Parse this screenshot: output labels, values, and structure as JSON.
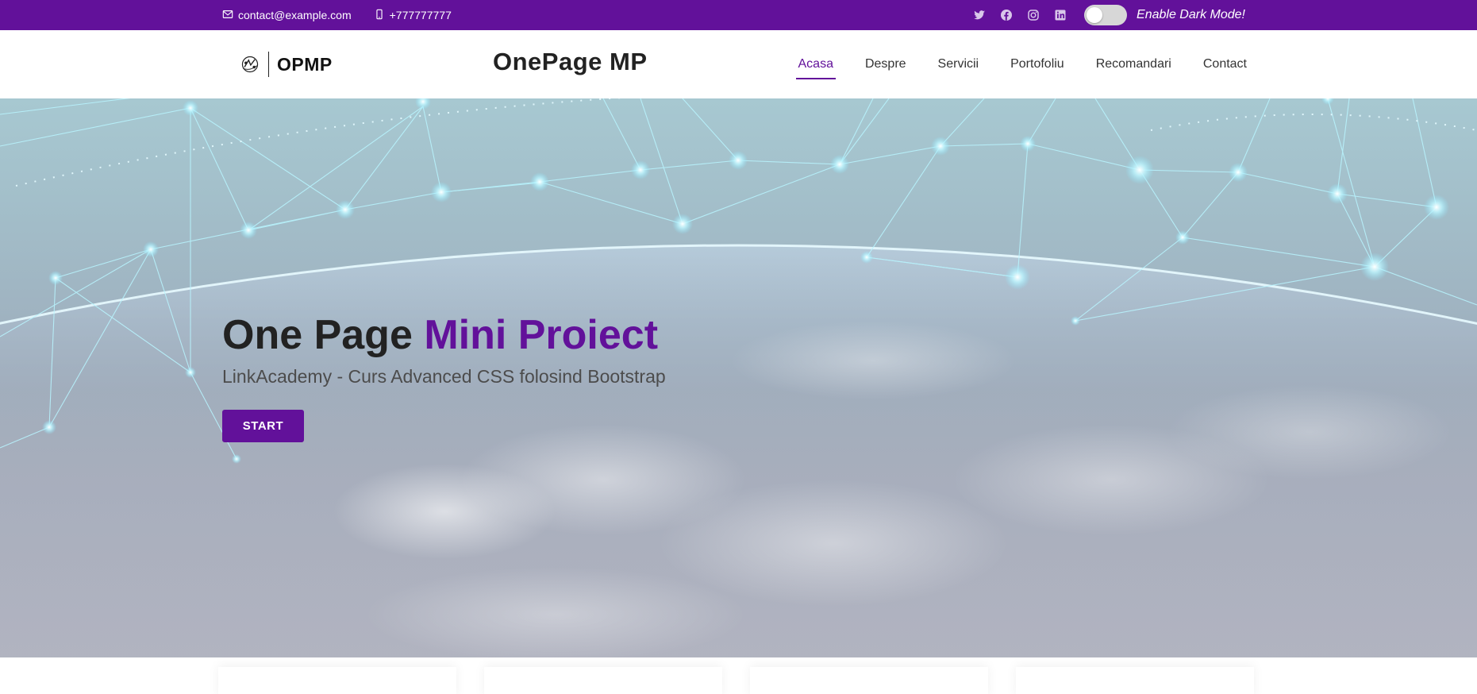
{
  "topbar": {
    "email": "contact@example.com",
    "phone": "+777777777",
    "email_icon": "envelope-icon",
    "phone_icon": "phone-icon",
    "social": [
      "twitter-icon",
      "facebook-icon",
      "instagram-icon",
      "linkedin-icon"
    ],
    "dark_mode_label": "Enable Dark Mode!",
    "dark_mode_enabled": false
  },
  "header": {
    "logo_text": "OPMP",
    "site_title": "OnePage MP",
    "nav": [
      {
        "label": "Acasa",
        "active": true
      },
      {
        "label": "Despre",
        "active": false
      },
      {
        "label": "Servicii",
        "active": false
      },
      {
        "label": "Portofoliu",
        "active": false
      },
      {
        "label": "Recomandari",
        "active": false
      },
      {
        "label": "Contact",
        "active": false
      }
    ]
  },
  "hero": {
    "title_main": "One Page ",
    "title_accent": "Mini Proiect",
    "subtitle": "LinkAcademy - Curs Advanced CSS folosind Bootstrap",
    "button_label": "START"
  },
  "colors": {
    "brand": "#62119a",
    "text_dark": "#222222"
  }
}
